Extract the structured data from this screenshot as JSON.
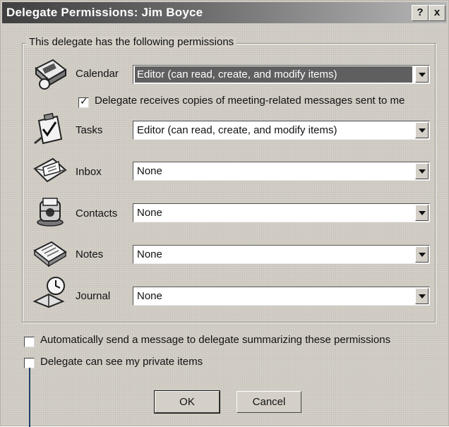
{
  "window": {
    "title": "Delegate Permissions: Jim Boyce",
    "help_label": "?",
    "close_label": "x"
  },
  "group": {
    "label": "This delegate has the following permissions"
  },
  "folders": {
    "calendar": {
      "label": "Calendar",
      "value": "Editor (can read, create, and modify items)",
      "icon": "calendar-icon"
    },
    "tasks": {
      "label": "Tasks",
      "value": "Editor (can read, create, and modify items)",
      "icon": "tasks-icon"
    },
    "inbox": {
      "label": "Inbox",
      "value": "None",
      "icon": "inbox-icon"
    },
    "contacts": {
      "label": "Contacts",
      "value": "None",
      "icon": "contacts-icon"
    },
    "notes": {
      "label": "Notes",
      "value": "None",
      "icon": "notes-icon"
    },
    "journal": {
      "label": "Journal",
      "value": "None",
      "icon": "journal-icon"
    }
  },
  "meeting_copies": {
    "label": "Delegate receives copies of meeting-related messages sent to me",
    "checked": true
  },
  "options": {
    "auto_summary": {
      "label": "Automatically send a message to delegate summarizing these permissions",
      "checked": false
    },
    "private_items": {
      "label": "Delegate can see my private items",
      "checked": false
    }
  },
  "buttons": {
    "ok": "OK",
    "cancel": "Cancel"
  }
}
